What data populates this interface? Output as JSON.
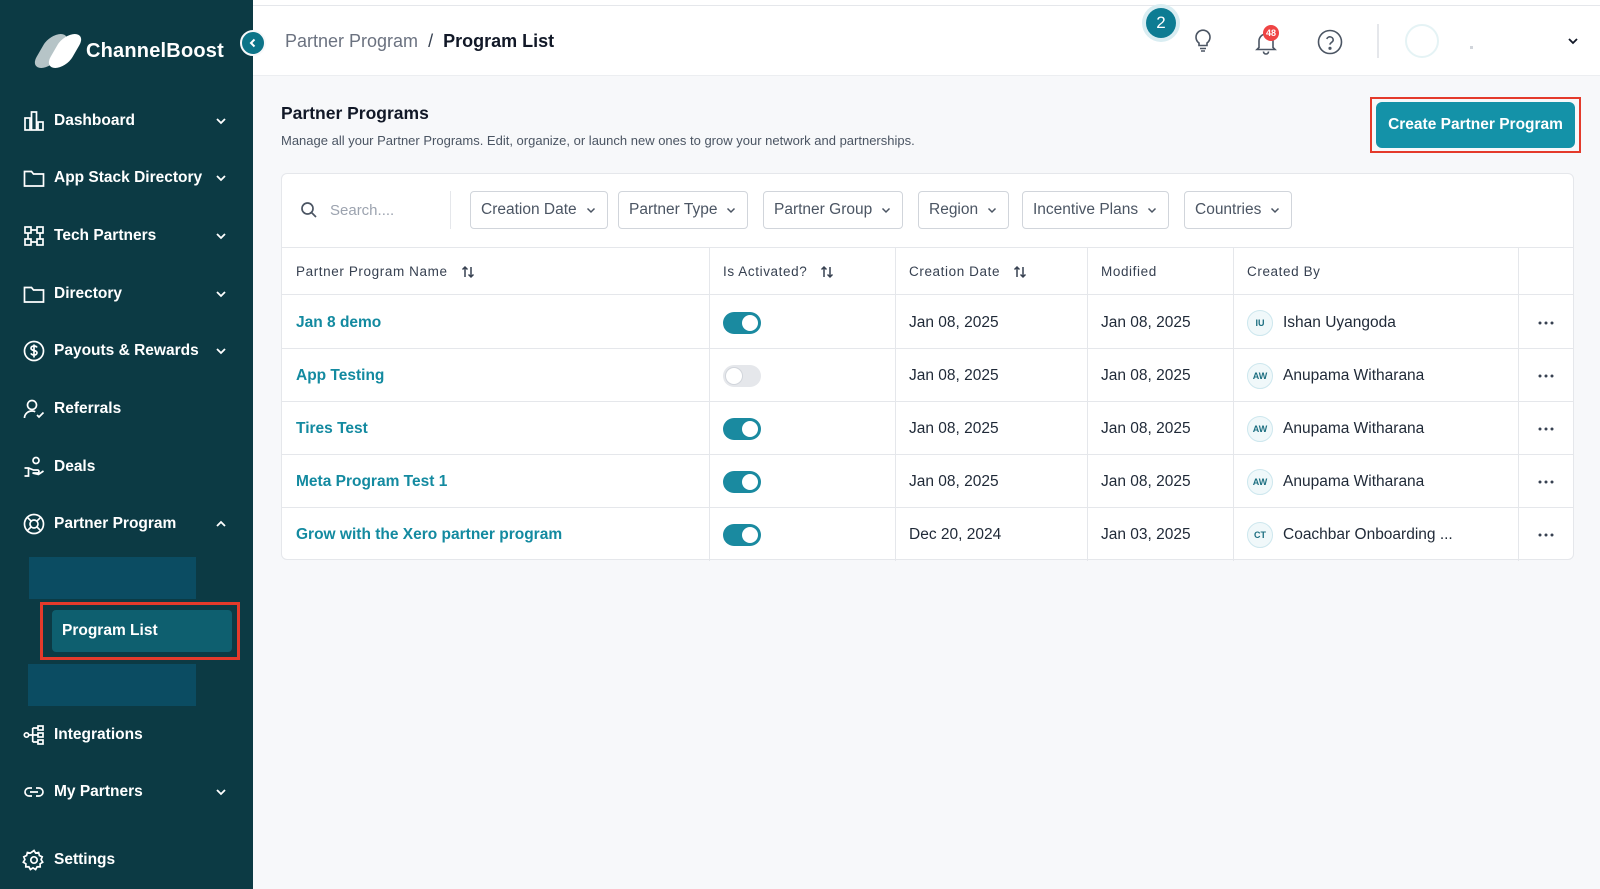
{
  "app": {
    "name": "ChannelBoost"
  },
  "sidebar": {
    "items": [
      {
        "label": "Dashboard",
        "icon": "chart-bar-icon",
        "expandable": true
      },
      {
        "label": "App Stack Directory",
        "icon": "folder-icon",
        "expandable": true
      },
      {
        "label": "Tech Partners",
        "icon": "network-icon",
        "expandable": true
      },
      {
        "label": "Directory",
        "icon": "folder-icon",
        "expandable": true
      },
      {
        "label": "Payouts & Rewards",
        "icon": "dollar-circle-icon",
        "expandable": true
      },
      {
        "label": "Referrals",
        "icon": "user-check-icon",
        "expandable": false
      },
      {
        "label": "Deals",
        "icon": "handshake-icon",
        "expandable": false
      },
      {
        "label": "Partner Program",
        "icon": "lifebuoy-icon",
        "expandable": true,
        "expanded": true
      },
      {
        "label": "Integrations",
        "icon": "integrations-icon",
        "expandable": false
      },
      {
        "label": "My Partners",
        "icon": "link-icon",
        "expandable": true
      },
      {
        "label": "Settings",
        "icon": "gear-icon",
        "expandable": false
      }
    ],
    "active_subitem": "Program List"
  },
  "header": {
    "breadcrumb_parent": "Partner Program",
    "breadcrumb_separator": "/",
    "breadcrumb_current": "Program List",
    "tips_count": "2",
    "notifications_count": "48"
  },
  "main": {
    "title": "Partner Programs",
    "subtitle": "Manage all your Partner Programs. Edit, organize, or launch new ones to grow your network and partnerships.",
    "create_button": "Create Partner Program",
    "search_placeholder": "Search....",
    "filters": [
      "Creation Date",
      "Partner Type",
      "Partner Group",
      "Region",
      "Incentive Plans",
      "Countries"
    ],
    "columns": [
      "Partner Program Name",
      "Is Activated?",
      "Creation Date",
      "Modified",
      "Created By"
    ],
    "rows": [
      {
        "name": "Jan 8 demo",
        "activated": true,
        "created": "Jan 08, 2025",
        "modified": "Jan 08, 2025",
        "initials": "IU",
        "created_by": "Ishan Uyangoda"
      },
      {
        "name": "App Testing",
        "activated": false,
        "created": "Jan 08, 2025",
        "modified": "Jan 08, 2025",
        "initials": "AW",
        "created_by": "Anupama Witharana"
      },
      {
        "name": "Tires Test",
        "activated": true,
        "created": "Jan 08, 2025",
        "modified": "Jan 08, 2025",
        "initials": "AW",
        "created_by": "Anupama Witharana"
      },
      {
        "name": "Meta Program Test 1",
        "activated": true,
        "created": "Jan 08, 2025",
        "modified": "Jan 08, 2025",
        "initials": "AW",
        "created_by": "Anupama Witharana"
      },
      {
        "name": "Grow with the Xero partner program",
        "activated": true,
        "created": "Dec 20, 2024",
        "modified": "Jan 03, 2025",
        "initials": "CT",
        "created_by": "Coachbar Onboarding ..."
      }
    ]
  },
  "colors": {
    "sidebar_bg": "#0c3a44",
    "accent": "#1492a8",
    "link": "#138aa0",
    "highlight_outline": "#e43a2b"
  }
}
